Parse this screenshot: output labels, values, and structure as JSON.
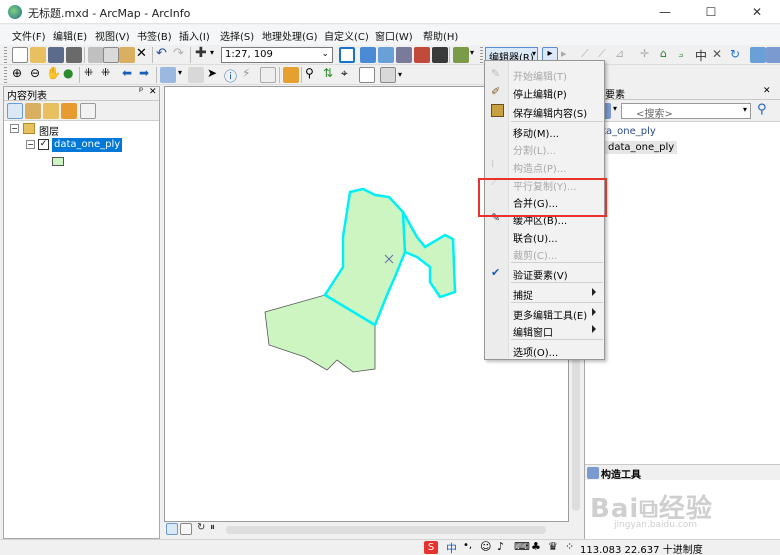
{
  "window": {
    "title": "无标题.mxd - ArcMap - ArcInfo",
    "minimize": "—",
    "maximize": "☐",
    "close": "✕"
  },
  "menubar": {
    "items": [
      "文件(F)",
      "编辑(E)",
      "视图(V)",
      "书签(B)",
      "插入(I)",
      "选择(S)",
      "地理处理(G)",
      "自定义(C)",
      "窗口(W)",
      "帮助(H)"
    ]
  },
  "toolbar": {
    "scale": "1:27, 109",
    "editor_label": "编辑器(R)"
  },
  "toc": {
    "title": "内容列表",
    "pin": "ᵖ",
    "close": "✕",
    "layers_label": "图层",
    "layer_name": "data_one_ply"
  },
  "editor_menu": {
    "items": [
      {
        "label": "开始编辑(T)",
        "disabled": true,
        "submenu": false
      },
      {
        "label": "停止编辑(P)",
        "disabled": false,
        "submenu": false
      },
      {
        "label": "保存编辑内容(S)",
        "disabled": false,
        "submenu": false
      },
      {
        "label": "移动(M)...",
        "disabled": false,
        "submenu": false
      },
      {
        "label": "分割(L)...",
        "disabled": true,
        "submenu": false
      },
      {
        "label": "构造点(P)...",
        "disabled": true,
        "submenu": false
      },
      {
        "label": "平行复制(Y)...",
        "disabled": true,
        "submenu": false
      },
      {
        "label": "合并(G)...",
        "disabled": false,
        "submenu": false
      },
      {
        "label": "缓冲区(B)...",
        "disabled": false,
        "submenu": false
      },
      {
        "label": "联合(U)...",
        "disabled": false,
        "submenu": false
      },
      {
        "label": "裁剪(C)...",
        "disabled": true,
        "submenu": false
      },
      {
        "label": "验证要素(V)",
        "disabled": false,
        "submenu": false
      },
      {
        "label": "捕捉",
        "disabled": false,
        "submenu": true
      },
      {
        "label": "更多编辑工具(E)",
        "disabled": false,
        "submenu": true
      },
      {
        "label": "编辑窗口",
        "disabled": false,
        "submenu": true
      },
      {
        "label": "选项(O)...",
        "disabled": false,
        "submenu": false
      }
    ]
  },
  "right_panel": {
    "title": "要素",
    "search_placeholder": "<搜索>",
    "template_group": "ata_one_ply",
    "template_item": "data_one_ply",
    "construct_tools": "构造工具"
  },
  "status": {
    "coords": "113.083  22.637 十进制度"
  },
  "colors": {
    "polygon_fill": "#ccf5c2",
    "selection_outline": "#00f0f5",
    "highlight_box": "#e8332c",
    "toc_selected": "#0078d7"
  }
}
